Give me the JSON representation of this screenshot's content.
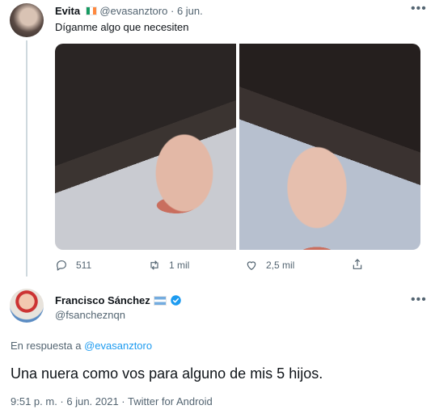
{
  "tweet": {
    "author_name": "Evita",
    "flag_icon": "ireland-flag-icon",
    "handle": "@evasanztoro",
    "separator": "·",
    "date": "6 jun.",
    "text": "Díganme algo que necesiten",
    "actions": {
      "replies": "511",
      "retweets": "1 mil",
      "likes": "2,5 mil"
    }
  },
  "reply": {
    "author_name": "Francisco Sánchez",
    "flag_icon": "argentina-flag-icon",
    "verified_icon": "verified-badge-icon",
    "handle": "@fsancheznqn",
    "in_reply_prefix": "En respuesta a",
    "in_reply_handle": "@evasanztoro",
    "text": "Una nuera como vos para alguno de mis 5 hijos.",
    "meta": "9:51 p. m. · 6 jun. 2021 · Twitter for Android"
  },
  "colors": {
    "accent": "#1d9bf0",
    "muted": "#536471",
    "thread_line": "#cfd9de"
  }
}
